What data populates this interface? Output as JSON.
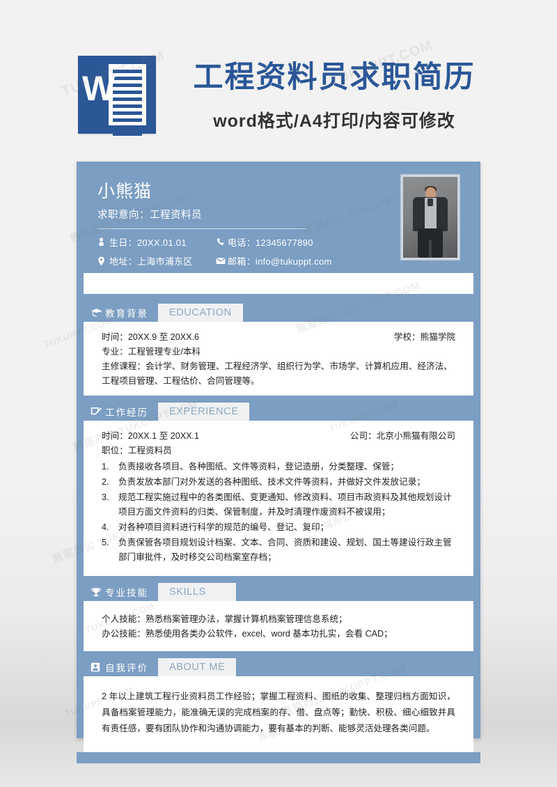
{
  "banner": {
    "logo_letter": "W",
    "logo_name": "word-logo",
    "title": "工程资料员求职简历",
    "subtitle": "word格式/A4打印/内容可修改"
  },
  "colors": {
    "brand_blue": "#2b5797",
    "resume_blue": "#7b9ec2",
    "tab_gray": "#f0f1f3",
    "tab_en_text": "#8fa8c2",
    "page_bg": "#f2f2f2"
  },
  "watermarks": [
    "TUKUPPT.COM",
    "熊猫办公",
    "熊猫办公 TUKUPPT.COM"
  ],
  "header": {
    "name": "小熊猫",
    "objective_label": "求职意向：",
    "objective_value": "工程资料员",
    "objective": "求职意向：工程资料员",
    "photo_alt": "证件照片",
    "contacts": [
      {
        "icon": "birthday-icon",
        "label": "生日：",
        "value": "20XX.01.01",
        "text": "生日：20XX.01.01"
      },
      {
        "icon": "phone-icon",
        "label": "电话：",
        "value": "12345677890",
        "text": "电话：12345677890"
      },
      {
        "icon": "location-icon",
        "label": "地址：",
        "value": "上海市浦东区",
        "text": "地址：上海市浦东区"
      },
      {
        "icon": "mail-icon",
        "label": "邮箱：",
        "value": "info@tukuppt.com",
        "text": "邮箱：info@tukuppt.com"
      }
    ]
  },
  "sections": {
    "education": {
      "icon": "graduation-cap-icon",
      "title_cn": "教育背景",
      "title_en": "EDUCATION",
      "time": "时间：20XX.9 至 20XX.6",
      "school": "学校：熊猫学院",
      "major": "专业：工程管理专业/本科",
      "courses": "主修课程：会计学、财务管理、工程经济学、组织行为学、市场学、计算机应用、经济法、工程项目管理、工程估价、合同管理等。"
    },
    "experience": {
      "icon": "note-edit-icon",
      "title_cn": "工作经历",
      "title_en": "EXPERIENCE",
      "time": "时间：20XX.1 至 20XX.1",
      "company": "公司：北京小熊猫有限公司",
      "position": "职位：工程资料员",
      "duties": [
        {
          "num": "1.",
          "text": "负责接收各项目、各种图纸、文件等资料，登记造册，分类整理、保管；"
        },
        {
          "num": "2.",
          "text": "负责发放本部门对外发送的各种图纸、技术文件等资料，并做好文件发放记录；"
        },
        {
          "num": "3.",
          "text": "规范工程实施过程中的各类图纸、变更通知、修改资料、项目市政资料及其他规划设计项目方面文件资料的归类、保管制度，并及时清理作废资料不被误用；"
        },
        {
          "num": "4.",
          "text": "对各种项目资料进行科学的规范的编号、登记、复印；"
        },
        {
          "num": "5.",
          "text": "负责保管各项目规划设计档案、文本、合同、资质和建设、规划、国土等建设行政主管部门审批件，及时移交公司档案室存档；"
        }
      ]
    },
    "skills": {
      "icon": "trophy-icon",
      "title_cn": "专业技能",
      "title_en": "SKILLS",
      "items": [
        "个人技能：熟悉档案管理办法，掌握计算机档案管理信息系统；",
        "办公技能：熟悉使用各类办公软件，excel、word 基本功扎实，会看 CAD；"
      ]
    },
    "about": {
      "icon": "user-card-icon",
      "title_cn": "自我评价",
      "title_en": "ABOUT ME",
      "text": "2 年以上建筑工程行业资料员工作经验；掌握工程资料、图纸的收集、整理归档方面知识，具备档案管理能力，能准确无误的完成档案的存、借、盘点等；勤快、积极、细心细致并具有责任感，要有团队协作和沟通协调能力，要有基本的判断、能够灵活处理各类问题。"
    }
  }
}
